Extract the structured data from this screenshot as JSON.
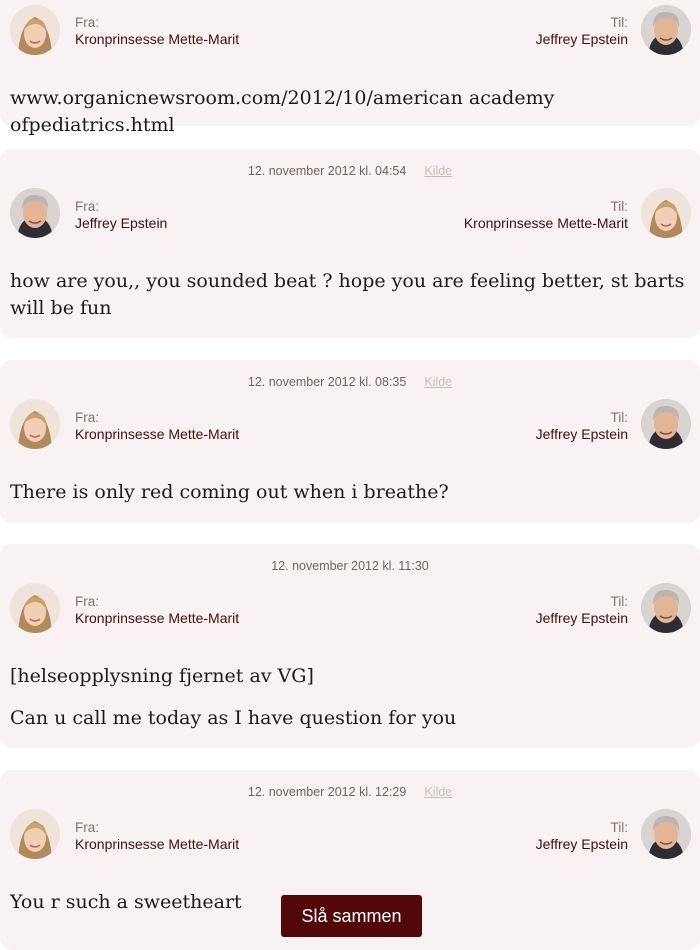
{
  "labels": {
    "from": "Fra:",
    "to": "Til:",
    "source": "Kilde"
  },
  "people": {
    "mm": "Kronprinsesse Mette-Marit",
    "je": "Jeffrey Epstein"
  },
  "messages": [
    {
      "date": "",
      "has_source": false,
      "from": "Kronprinsesse Mette-Marit",
      "to": "Jeffrey Epstein",
      "body": [
        "www.organicnewsroom.com/2012/10/american academy ofpediatrics.html"
      ]
    },
    {
      "date": "12. november 2012 kl. 04:54",
      "has_source": true,
      "from": "Jeffrey Epstein",
      "to": "Kronprinsesse Mette-Marit",
      "body": [
        "how are you,, you sounded beat ? hope you are feeling better, st barts will be fun"
      ]
    },
    {
      "date": "12. november 2012 kl. 08:35",
      "has_source": true,
      "from": "Kronprinsesse Mette-Marit",
      "to": "Jeffrey Epstein",
      "body": [
        "There is only red coming out when i breathe?"
      ]
    },
    {
      "date": "12. november 2012 kl. 11:30",
      "has_source": false,
      "from": "Kronprinsesse Mette-Marit",
      "to": "Jeffrey Epstein",
      "body": [
        "[helseopplysning fjernet av VG]",
        "Can u call me today as I have question for you"
      ]
    },
    {
      "date": "12. november 2012 kl. 12:29",
      "has_source": true,
      "from": "Kronprinsesse Mette-Marit",
      "to": "Jeffrey Epstein",
      "body": [
        "You r such a sweetheart"
      ]
    }
  ],
  "merge_button": "Slå sammen",
  "colors": {
    "accent_bar": "#e30613",
    "name_text": "#4a0c0c",
    "button_bg": "#520808",
    "card_bg": "#f8f3f2"
  }
}
